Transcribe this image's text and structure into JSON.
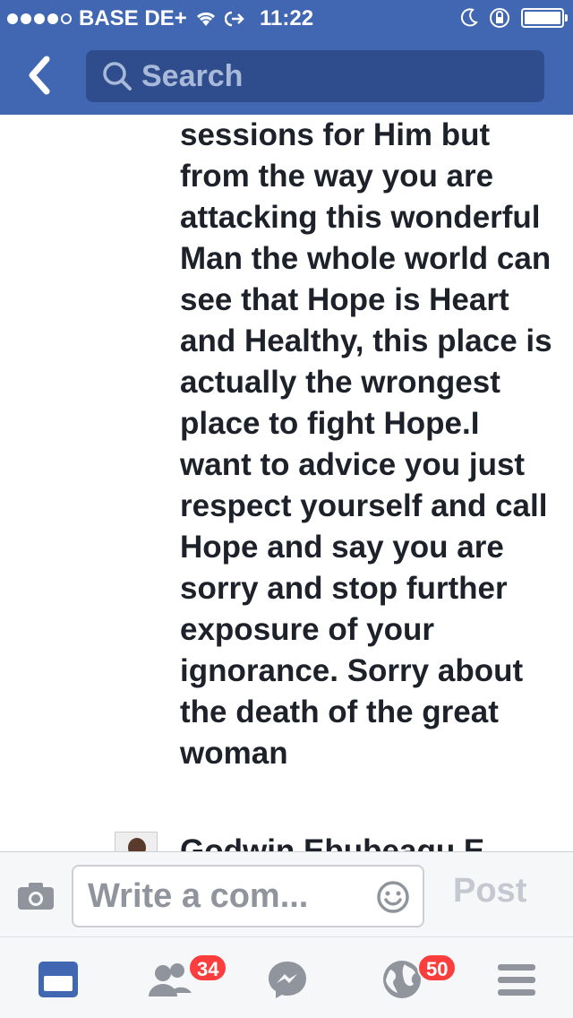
{
  "status_bar": {
    "carrier": "BASE DE+",
    "time": "11:22"
  },
  "nav": {
    "search_placeholder": "Search"
  },
  "comment": {
    "text": "sessions for Him but from the way you are attacking this wonderful Man the whole world can see that Hope is Heart and Healthy, this place is actually the wrongest place to fight Hope.I want to advice you just respect yourself and call Hope and say you are sorry and stop further exposure of your ignorance. Sorry about the death of the great woman"
  },
  "next_comment": {
    "author": "Godwin Ebubeagu E"
  },
  "composer": {
    "placeholder": "Write a com...",
    "post_label": "Post"
  },
  "tabbar": {
    "friends_badge": "34",
    "notifications_badge": "50"
  },
  "colors": {
    "brand": "#4267b2",
    "badge": "#fa3e3e",
    "text": "#1d2129"
  }
}
